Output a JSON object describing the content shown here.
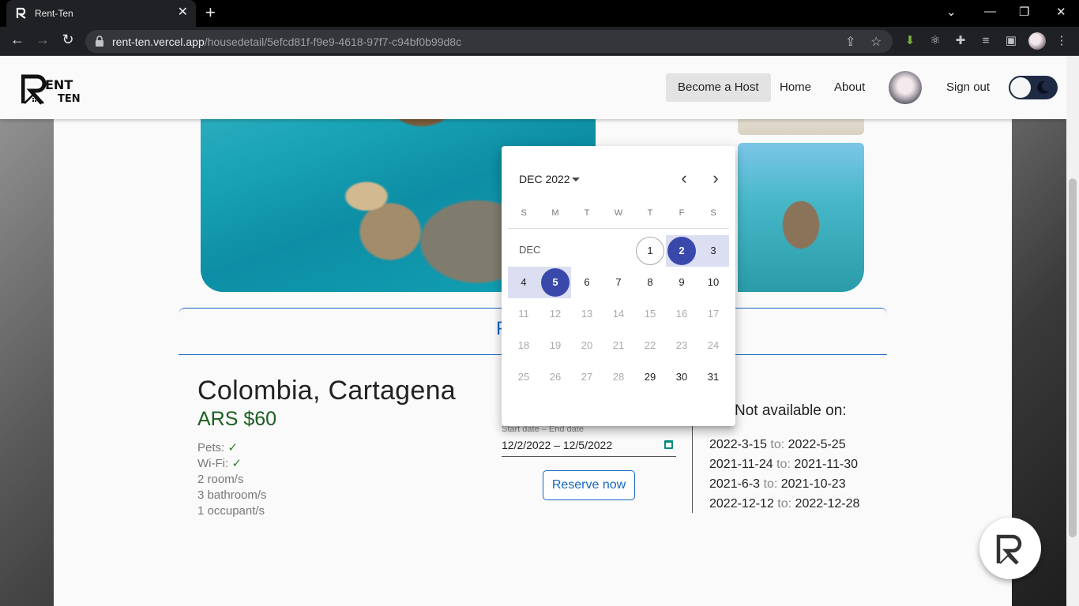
{
  "browser": {
    "tab_title": "Rent-Ten",
    "url_host": "rent-ten.vercel.app",
    "url_path": "/housedetail/5efcd81f-f9e9-4618-97f7-c94bf0b99d8c"
  },
  "header": {
    "nav": {
      "become_host": "Become a Host",
      "home": "Home",
      "about": "About",
      "sign_out": "Sign out"
    }
  },
  "listing": {
    "tab_label": "P",
    "city": "Colombia, Cartagena",
    "price": "ARS $60",
    "pets_label": "Pets:",
    "wifi_label": "Wi-Fi:",
    "check": "✓",
    "rooms": "2 room/s",
    "bathrooms": "3 bathroom/s",
    "occupants": "1 occupant/s"
  },
  "booking": {
    "date_label": "Start date – End date",
    "date_value": "12/2/2022 – 12/5/2022",
    "reserve_label": "Reserve now"
  },
  "availability": {
    "title": "Not available on:",
    "to_label": "to:",
    "ranges": [
      {
        "from": "2022-3-15",
        "to": "2022-5-25"
      },
      {
        "from": "2021-11-24",
        "to": "2021-11-30"
      },
      {
        "from": "2021-6-3",
        "to": "2021-10-23"
      },
      {
        "from": "2022-12-12",
        "to": "2022-12-28"
      }
    ]
  },
  "datepicker": {
    "month_button": "DEC 2022",
    "month_label": "DEC",
    "weekdays": [
      "S",
      "M",
      "T",
      "W",
      "T",
      "F",
      "S"
    ],
    "days": [
      "1",
      "2",
      "3",
      "4",
      "5",
      "6",
      "7",
      "8",
      "9",
      "10",
      "11",
      "12",
      "13",
      "14",
      "15",
      "16",
      "17",
      "18",
      "19",
      "20",
      "21",
      "22",
      "23",
      "24",
      "25",
      "26",
      "27",
      "28",
      "29",
      "30",
      "31"
    ],
    "selected_start": "2",
    "selected_end": "5",
    "today": "1"
  }
}
